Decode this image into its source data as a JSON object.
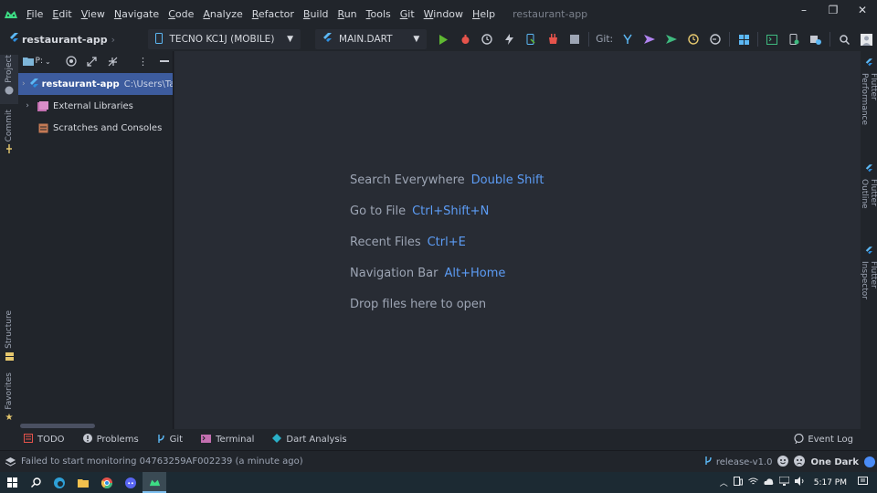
{
  "menubar": {
    "items": [
      "File",
      "Edit",
      "View",
      "Navigate",
      "Code",
      "Analyze",
      "Refactor",
      "Build",
      "Run",
      "Tools",
      "Git",
      "Window",
      "Help"
    ],
    "window_title": "restaurant-app",
    "controls": {
      "minimize": "–",
      "restore": "❐",
      "close": "✕"
    }
  },
  "toolbar": {
    "project_crumb": "restaurant-app",
    "device": "TECNO KC1J (MOBILE)",
    "run_config": "MAIN.DART",
    "git_label": "Git:"
  },
  "left_strip": {
    "project": "Project",
    "commit": "Commit",
    "structure": "Structure",
    "favorites": "Favorites"
  },
  "right_strip": {
    "performance": "Flutter Performance",
    "outline": "Flutter Outline",
    "inspector": "Flutter Inspector"
  },
  "project_panel": {
    "view_selector": "P:",
    "tree": [
      {
        "name": "restaurant-app",
        "path": "C:\\Users\\Tawh"
      },
      {
        "name": "External Libraries"
      },
      {
        "name": "Scratches and Consoles"
      }
    ]
  },
  "editor": {
    "hints": [
      {
        "text": "Search Everywhere",
        "key": "Double Shift"
      },
      {
        "text": "Go to File",
        "key": "Ctrl+Shift+N"
      },
      {
        "text": "Recent Files",
        "key": "Ctrl+E"
      },
      {
        "text": "Navigation Bar",
        "key": "Alt+Home"
      },
      {
        "text": "Drop files here to open",
        "key": ""
      }
    ]
  },
  "bottom_tools": {
    "todo": "TODO",
    "problems": "Problems",
    "git": "Git",
    "terminal": "Terminal",
    "dart_analysis": "Dart Analysis",
    "event_log": "Event Log"
  },
  "statusbar": {
    "message": "Failed to start monitoring 04763259AF002239 (a minute ago)",
    "branch": "release-v1.0",
    "theme": "One Dark"
  },
  "taskbar": {
    "clock": "5:17 PM"
  },
  "colors": {
    "accent": "#3d5c9e",
    "hint_key": "#5c9cf5",
    "editor_bg": "#282c34",
    "panel_bg": "#21252b"
  }
}
